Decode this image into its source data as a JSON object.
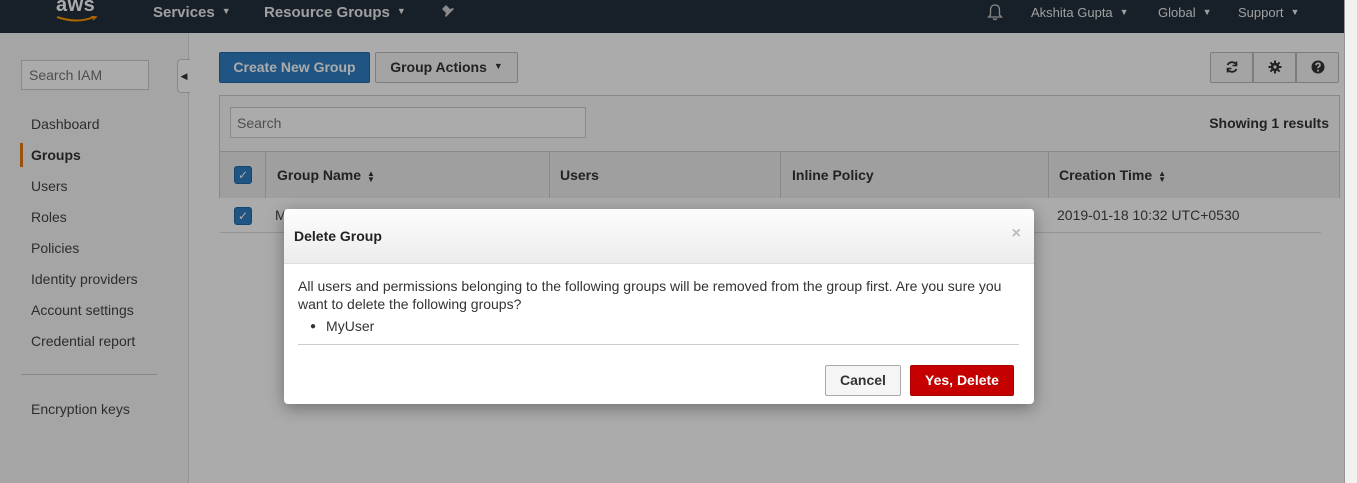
{
  "topbar": {
    "logo": "aws",
    "services": "Services",
    "resource_groups": "Resource Groups",
    "user": "Akshita Gupta",
    "region": "Global",
    "support": "Support"
  },
  "sidebar": {
    "search_placeholder": "Search IAM",
    "items": [
      {
        "label": "Dashboard"
      },
      {
        "label": "Groups"
      },
      {
        "label": "Users"
      },
      {
        "label": "Roles"
      },
      {
        "label": "Policies"
      },
      {
        "label": "Identity providers"
      },
      {
        "label": "Account settings"
      },
      {
        "label": "Credential report"
      },
      {
        "label": "Encryption keys"
      }
    ],
    "active": "Groups"
  },
  "toolbar": {
    "create_label": "Create New Group",
    "actions_label": "Group Actions"
  },
  "table": {
    "search_placeholder": "Search",
    "results_label": "Showing 1 results",
    "headers": [
      "Group Name",
      "Users",
      "Inline Policy",
      "Creation Time"
    ],
    "rows": [
      {
        "group_name": "M",
        "users": "",
        "inline_policy": "",
        "creation_time": "2019-01-18 10:32 UTC+0530",
        "checked": true
      }
    ]
  },
  "modal": {
    "title": "Delete Group",
    "close_glyph": "×",
    "message": "All users and permissions belonging to the following groups will be removed from the group first. Are you sure you want to delete the following groups?",
    "groups": [
      "MyUser"
    ],
    "cancel_label": "Cancel",
    "confirm_label": "Yes, Delete"
  },
  "colors": {
    "topbar": "#232f3e",
    "primary": "#2f7ec4",
    "danger": "#c40000",
    "active_marker": "#e47911"
  }
}
